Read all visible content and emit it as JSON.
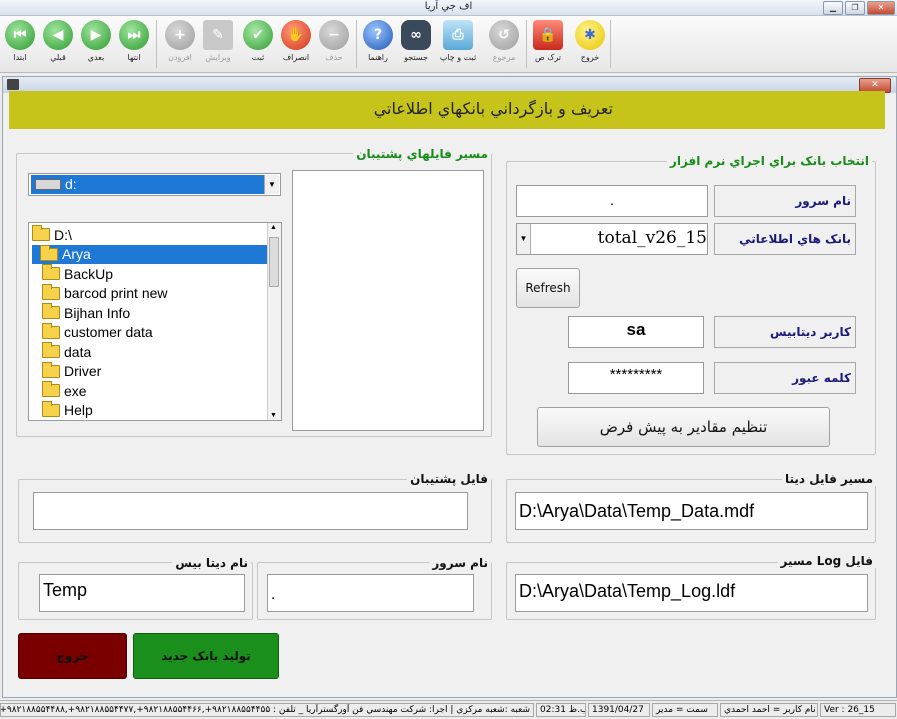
{
  "window_title": "اف جي آريا",
  "toolbar": {
    "buttons": [
      {
        "label": "ابتدا",
        "icon": "first-record-icon"
      },
      {
        "label": "قبلي",
        "icon": "previous-record-icon"
      },
      {
        "label": "بعدي",
        "icon": "next-record-icon"
      },
      {
        "label": "انتها",
        "icon": "last-record-icon"
      },
      {
        "label": "افزودن",
        "icon": "add-icon"
      },
      {
        "label": "ويرايش",
        "icon": "edit-icon"
      },
      {
        "label": "ثبت",
        "icon": "save-checkmark-icon"
      },
      {
        "label": "انصراف",
        "icon": "cancel-hand-icon"
      },
      {
        "label": "حذف",
        "icon": "delete-icon"
      },
      {
        "label": "راهنما",
        "icon": "help-icon"
      },
      {
        "label": "جستجو",
        "icon": "binoculars-search-icon"
      },
      {
        "label": "ثبت و چاپ",
        "icon": "print-icon"
      },
      {
        "label": "مرجوع",
        "icon": "return-icon"
      },
      {
        "label": "ترک ص",
        "icon": "lock-icon"
      },
      {
        "label": "خروج",
        "icon": "exit-icon"
      }
    ]
  },
  "form": {
    "header_title": "تعريف و بازگرداني بانکهاي اطلاعاتي",
    "backup_path": {
      "legend": "مسير فايلهاي پشتيبان",
      "drive_value": "d:",
      "tree": [
        "D:\\",
        "Arya",
        "BackUp",
        "barcod print new",
        "Bijhan Info",
        "customer data",
        "data",
        "Driver",
        "exe",
        "Help"
      ],
      "selected_index": 1
    },
    "bank_select": {
      "legend": "انتخاب بانک براي اجراي نرم افزار",
      "server_label": "نام سرور",
      "server_value": ".",
      "db_label": "بانک هاي اطلاعاتي",
      "db_value": "total_v26_15",
      "refresh_label": "Refresh",
      "user_label": "کاربر ديتابيس",
      "user_value": "sa",
      "password_label": "کلمه عبور",
      "password_value": "*********",
      "default_button": "تنظيم مقادير به پيش فرض"
    },
    "backup_file": {
      "legend": "فايل پشتيبان",
      "value": ""
    },
    "data_file": {
      "legend": "مسير فايل ديتا",
      "value": "D:\\Arya\\Data\\Temp_Data.mdf"
    },
    "db_name": {
      "legend": "نام ديتا بيس",
      "value": "Temp"
    },
    "server_name": {
      "legend": "نام سرور",
      "value": "."
    },
    "log_file": {
      "legend": "مسير Log فايل",
      "value": "D:\\Arya\\Data\\Temp_Log.ldf"
    },
    "create_button": "توليد بانک جديد",
    "exit_button": "خروج"
  },
  "status_bar": {
    "version": "Ver : 26_15",
    "user": "نام کاربر = احمد احمدي",
    "role": "سمت = مدير",
    "date": "1391/04/27",
    "time": "ب.ظ 02:31",
    "info": "شعبه :شعبه مرکزي | اجرا: شرکت مهندسي فن آورگسترآريا _ تلفن : ۹۸۲۱۸۸۵۵۴۴۵۵+,۹۸۲۱۸۸۵۵۴۴۶۶+,۹۸۲۱۸۸۵۵۴۴۷۷+,۹۸۲۱۸۸۵۵۴۴۸۸+"
  },
  "colors": {
    "header_bg": "#c6c41a",
    "create_bg": "#1b8f1b",
    "exit_bg": "#7a0000",
    "legend_green": "#178b17"
  }
}
